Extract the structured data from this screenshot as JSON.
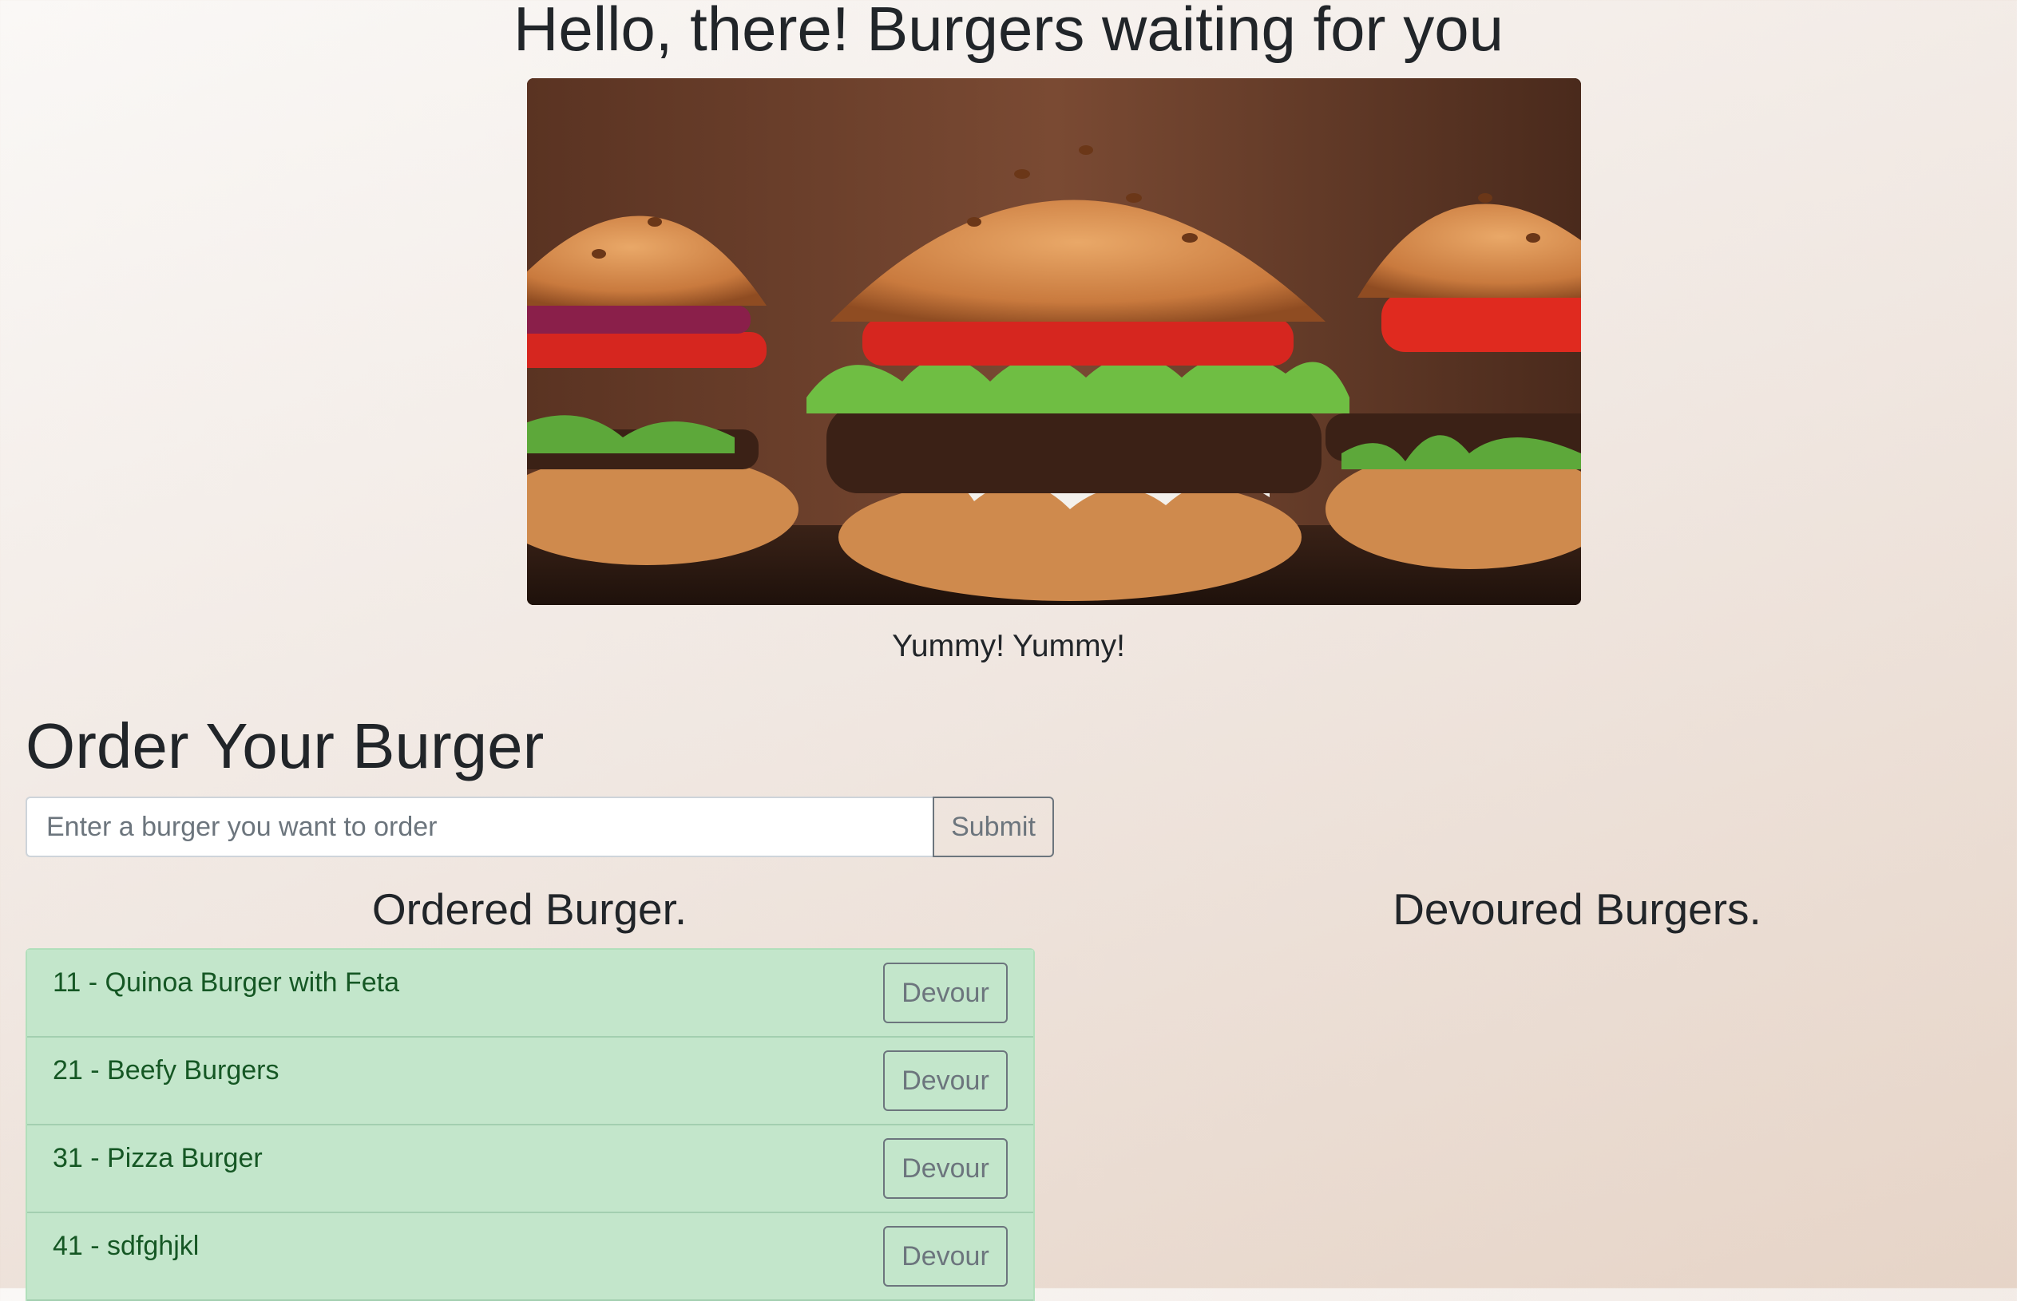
{
  "header": {
    "title": "Hello, there! Burgers waiting for you",
    "image_alt": "burgers-photo",
    "caption": "Yummy! Yummy!"
  },
  "order": {
    "title": "Order Your Burger",
    "input_placeholder": "Enter a burger you want to order",
    "input_value": "",
    "submit_label": "Submit"
  },
  "ordered": {
    "heading": "Ordered Burger.",
    "items": [
      {
        "label": "11 - Quinoa Burger with Feta",
        "button": "Devour"
      },
      {
        "label": "21 - Beefy Burgers",
        "button": "Devour"
      },
      {
        "label": "31 - Pizza Burger",
        "button": "Devour"
      },
      {
        "label": "41 - sdfghjkl",
        "button": "Devour"
      }
    ]
  },
  "devoured": {
    "heading": "Devoured Burgers.",
    "items": []
  },
  "colors": {
    "list_bg": "#c3e6cb",
    "list_text": "#155724",
    "button_outline": "#6c757d"
  }
}
